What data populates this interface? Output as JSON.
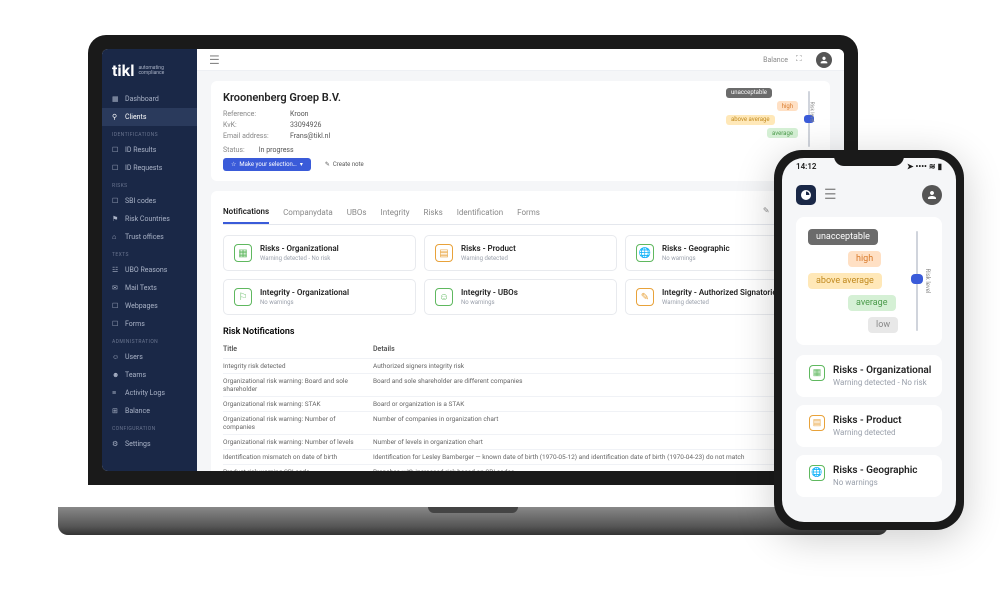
{
  "brand": {
    "name": "tikl",
    "tagline1": "automating",
    "tagline2": "compliance"
  },
  "sidebar": {
    "items": [
      {
        "label": "Dashboard"
      },
      {
        "label": "Clients"
      }
    ],
    "sections": [
      {
        "heading": "IDENTIFICATIONS",
        "items": [
          {
            "label": "ID Results"
          },
          {
            "label": "ID Requests"
          }
        ]
      },
      {
        "heading": "RISKS",
        "items": [
          {
            "label": "SBI codes"
          },
          {
            "label": "Risk Countries"
          },
          {
            "label": "Trust offices"
          }
        ]
      },
      {
        "heading": "TEXTS",
        "items": [
          {
            "label": "UBO Reasons"
          },
          {
            "label": "Mail Texts"
          },
          {
            "label": "Webpages"
          },
          {
            "label": "Forms"
          }
        ]
      },
      {
        "heading": "ADMINISTRATION",
        "items": [
          {
            "label": "Users"
          },
          {
            "label": "Teams"
          },
          {
            "label": "Activity Logs"
          },
          {
            "label": "Balance"
          }
        ]
      },
      {
        "heading": "CONFIGURATION",
        "items": [
          {
            "label": "Settings"
          }
        ]
      }
    ]
  },
  "topbar": {
    "balance": "Balance"
  },
  "client": {
    "name": "Kroonenberg Groep B.V.",
    "ref_label": "Reference:",
    "ref_value": "Kroon",
    "kvk_label": "KvK:",
    "kvk_value": "33094926",
    "email_label": "Email address:",
    "email_value": "Frans@tikl.nl",
    "status_label": "Status:",
    "status_value": "In progress",
    "action_button": "Make your selection…",
    "note_button": "Create note"
  },
  "risk_levels": {
    "unacceptable": "unacceptable",
    "high": "high",
    "above_average": "above average",
    "average": "average",
    "low": "low",
    "side_label": "Risk level"
  },
  "tabs": [
    {
      "label": "Notifications",
      "active": true
    },
    {
      "label": "Companydata"
    },
    {
      "label": "UBOs"
    },
    {
      "label": "Integrity"
    },
    {
      "label": "Risks"
    },
    {
      "label": "Identification"
    },
    {
      "label": "Forms"
    }
  ],
  "risk_cards": [
    {
      "title": "Risks - Organizational",
      "sub": "Warning detected - No risk",
      "color": "green",
      "icon": "building"
    },
    {
      "title": "Risks - Product",
      "sub": "Warning detected",
      "color": "orange",
      "icon": "doc"
    },
    {
      "title": "Risks - Geographic",
      "sub": "No warnings",
      "color": "green",
      "icon": "globe"
    },
    {
      "title": "Integrity - Organizational",
      "sub": "No warnings",
      "color": "green",
      "icon": "org"
    },
    {
      "title": "Integrity - UBOs",
      "sub": "No warnings",
      "color": "green",
      "icon": "user"
    },
    {
      "title": "Integrity - Authorized Signatories",
      "sub": "Warning detected",
      "color": "orange",
      "icon": "pen"
    }
  ],
  "notifications": {
    "heading": "Risk Notifications",
    "col_title": "Title",
    "col_details": "Details",
    "rows": [
      {
        "title": "Integrity risk detected",
        "details": "Authorized signers integrity risk"
      },
      {
        "title": "Organizational risk warning: Board and sole shareholder",
        "details": "Board and sole shareholder are different companies"
      },
      {
        "title": "Organizational risk warning: STAK",
        "details": "Board or organization is a STAK"
      },
      {
        "title": "Organizational risk warning: Number of companies",
        "details": "Number of companies in organization chart"
      },
      {
        "title": "Organizational risk warning: Number of levels",
        "details": "Number of levels in organization chart"
      },
      {
        "title": "Identification mismatch on date of birth",
        "details": "Identification for Lesley Bamberger — known date of birth (1970-05-12) and identification date of birth (1970-04-23) do not match"
      },
      {
        "title": "Product risk warning SBI code",
        "details": "Branches with increased risk based on SBI codes"
      }
    ]
  },
  "phone": {
    "time": "14:12",
    "risk_cards": [
      {
        "title": "Risks - Organizational",
        "sub": "Warning detected - No risk",
        "color": "green"
      },
      {
        "title": "Risks - Product",
        "sub": "Warning detected",
        "color": "orange"
      },
      {
        "title": "Risks - Geographic",
        "sub": "No warnings",
        "color": "green"
      }
    ]
  }
}
